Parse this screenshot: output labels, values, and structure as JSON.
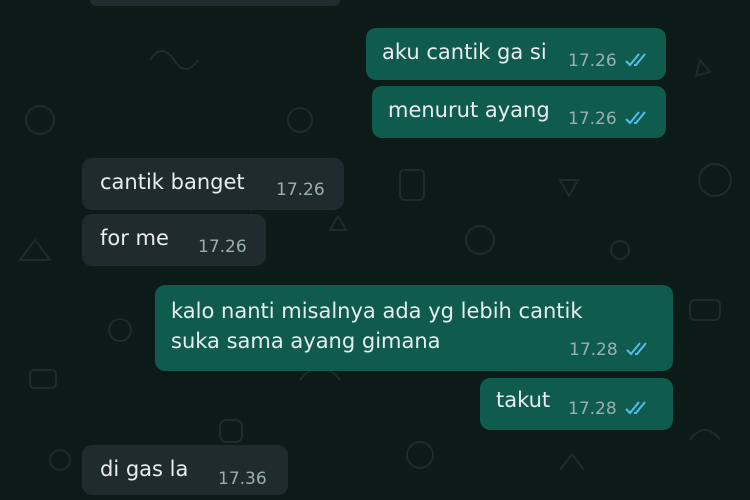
{
  "colors": {
    "chat_background": "#0c1a18",
    "outgoing_bubble": "#0f5c4e",
    "incoming_bubble": "#1f2b2d",
    "read_ticks": "#53bdeb"
  },
  "messages": [
    {
      "direction": "outgoing",
      "lines": [
        "aku cantik ga si"
      ],
      "time": "17.26",
      "status": "read",
      "status_icon": "double-check-icon"
    },
    {
      "direction": "outgoing",
      "lines": [
        "menurut ayang"
      ],
      "time": "17.26",
      "status": "read",
      "status_icon": "double-check-icon"
    },
    {
      "direction": "incoming",
      "lines": [
        "cantik banget"
      ],
      "time": "17.26"
    },
    {
      "direction": "incoming",
      "lines": [
        "for me"
      ],
      "time": "17.26"
    },
    {
      "direction": "outgoing",
      "lines": [
        "kalo nanti misalnya ada yg lebih cantik",
        "suka sama ayang gimana"
      ],
      "time": "17.28",
      "status": "read",
      "status_icon": "double-check-icon"
    },
    {
      "direction": "outgoing",
      "lines": [
        "takut"
      ],
      "time": "17.28",
      "status": "read",
      "status_icon": "double-check-icon"
    },
    {
      "direction": "incoming",
      "lines": [
        "di gas la"
      ],
      "time": "17.36"
    }
  ]
}
